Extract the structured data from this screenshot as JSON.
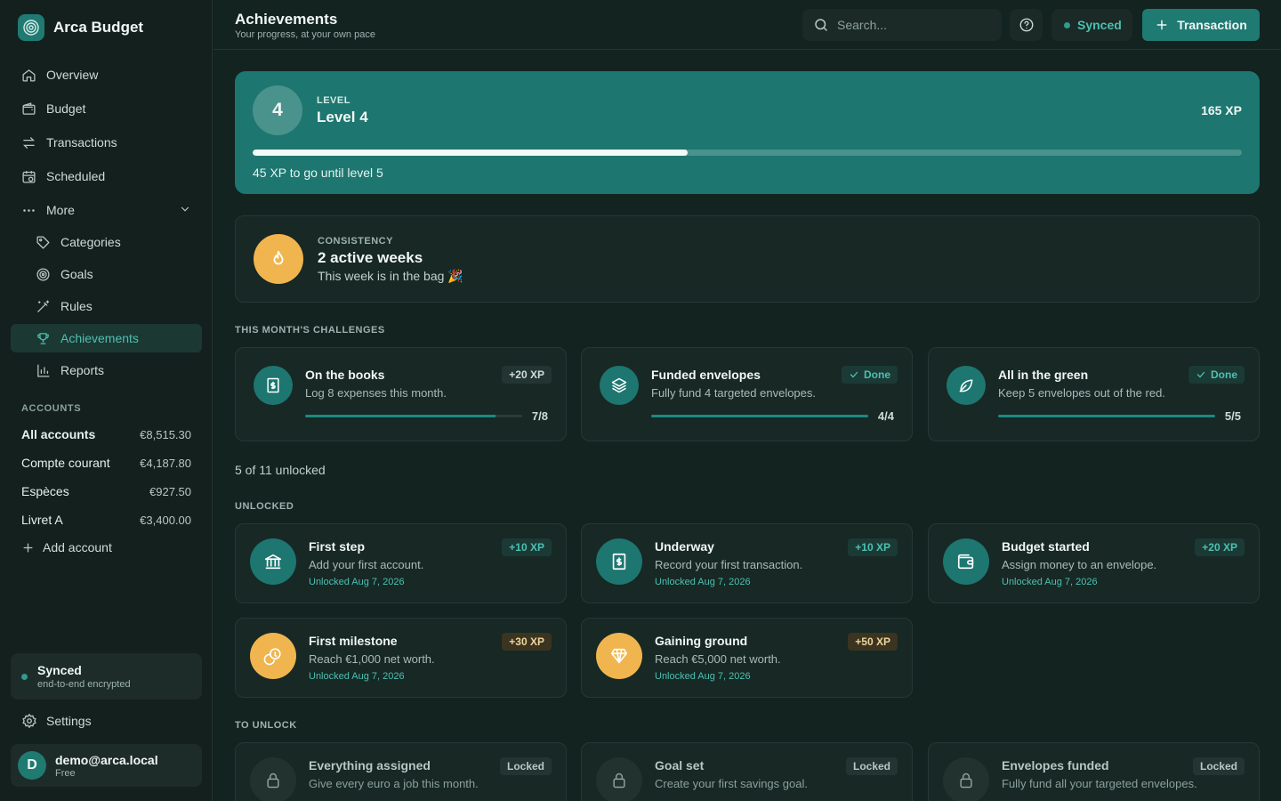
{
  "app": {
    "name": "Arca Budget"
  },
  "nav": {
    "overview": "Overview",
    "budget": "Budget",
    "transactions": "Transactions",
    "scheduled": "Scheduled",
    "more": "More",
    "categories": "Categories",
    "goals": "Goals",
    "rules": "Rules",
    "achievements": "Achievements",
    "reports": "Reports"
  },
  "accounts": {
    "label": "ACCOUNTS",
    "items": [
      {
        "name": "All accounts",
        "amount": "€8,515.30"
      },
      {
        "name": "Compte courant",
        "amount": "€4,187.80"
      },
      {
        "name": "Espèces",
        "amount": "€927.50"
      },
      {
        "name": "Livret A",
        "amount": "€3,400.00"
      }
    ],
    "add_label": "Add account"
  },
  "sync_card": {
    "title": "Synced",
    "subtitle": "end-to-end encrypted"
  },
  "settings_label": "Settings",
  "user": {
    "initial": "D",
    "email": "demo@arca.local",
    "plan": "Free"
  },
  "header": {
    "title": "Achievements",
    "subtitle": "Your progress, at your own pace",
    "search_placeholder": "Search...",
    "sync_status": "Synced",
    "transaction_button": "Transaction"
  },
  "level": {
    "badge": "4",
    "label": "LEVEL",
    "name": "Level 4",
    "xp": "165 XP",
    "progress": 0.44,
    "note": "45 XP to go until level 5"
  },
  "streak": {
    "label": "CONSISTENCY",
    "title": "2 active weeks",
    "subtitle": "This week is in the bag 🎉"
  },
  "challenges": {
    "heading": "THIS MONTH'S CHALLENGES",
    "items": [
      {
        "title": "On the books",
        "desc": "Log 8 expenses this month.",
        "tag": "+20 XP",
        "progress": "7/8",
        "fraction": 0.875
      },
      {
        "title": "Funded envelopes",
        "desc": "Fully fund 4 targeted envelopes.",
        "tag": "Done",
        "progress": "4/4",
        "fraction": 1
      },
      {
        "title": "All in the green",
        "desc": "Keep 5 envelopes out of the red.",
        "tag": "Done",
        "progress": "5/5",
        "fraction": 1
      }
    ]
  },
  "count_text": "5 of 11 unlocked",
  "unlocked": {
    "heading": "UNLOCKED",
    "items": [
      {
        "title": "First step",
        "desc": "Add your first account.",
        "tag": "+10 XP",
        "date": "Unlocked Aug 7, 2026",
        "icon": "bank-icon"
      },
      {
        "title": "Underway",
        "desc": "Record your first transaction.",
        "tag": "+10 XP",
        "date": "Unlocked Aug 7, 2026",
        "icon": "receipt-icon"
      },
      {
        "title": "Budget started",
        "desc": "Assign money to an envelope.",
        "tag": "+20 XP",
        "date": "Unlocked Aug 7, 2026",
        "icon": "wallet-icon"
      },
      {
        "title": "First milestone",
        "desc": "Reach €1,000 net worth.",
        "tag": "+30 XP",
        "date": "Unlocked Aug 7, 2026",
        "icon": "coins-icon"
      },
      {
        "title": "Gaining ground",
        "desc": "Reach €5,000 net worth.",
        "tag": "+50 XP",
        "date": "Unlocked Aug 7, 2026",
        "icon": "gem-icon"
      }
    ]
  },
  "locked": {
    "heading": "TO UNLOCK",
    "items": [
      {
        "title": "Everything assigned",
        "desc": "Give every euro a job this month.",
        "tag": "Locked"
      },
      {
        "title": "Goal set",
        "desc": "Create your first savings goal.",
        "tag": "Locked"
      },
      {
        "title": "Envelopes funded",
        "desc": "Fully fund all your targeted envelopes.",
        "tag": "Locked"
      }
    ]
  },
  "colors": {
    "accent": "#1d7670",
    "accent_text": "#4cc0b1",
    "gold": "#f0b54e",
    "background": "#122320"
  }
}
